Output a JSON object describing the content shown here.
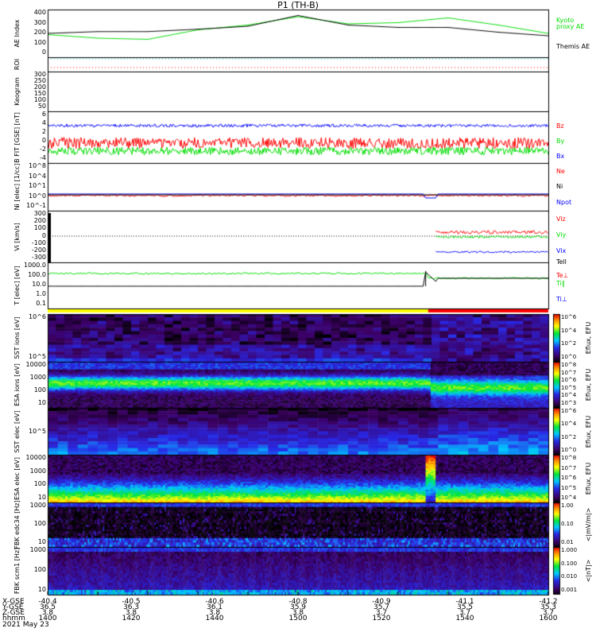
{
  "title": "P1 (TH-B)",
  "date": "2021 May 23",
  "colors": {
    "green": "#00dd00",
    "red": "#ff0000",
    "blue": "#0000ff",
    "yellow": "#ffff00"
  },
  "panels": [
    {
      "id": "ae",
      "label": "AE Index",
      "ticks": [
        "400",
        "300",
        "200",
        "100",
        "0"
      ]
    },
    {
      "id": "roi",
      "label": "ROI",
      "ticks": []
    },
    {
      "id": "keogram",
      "label": "Keogram",
      "ticks": [
        "300",
        "250",
        "200",
        "150",
        "100",
        "50"
      ]
    },
    {
      "id": "bfit",
      "label": "B FIT [GSE] [nT]",
      "ticks": [
        "6",
        "4",
        "2",
        "0",
        "-2",
        "-4"
      ]
    },
    {
      "id": "ni",
      "label": "Ni [elec] [1/cc]",
      "ticks": [
        "10^8",
        "10^4",
        "10^1",
        "10^0",
        "10^-1"
      ]
    },
    {
      "id": "vi",
      "label": "Vi [km/s]",
      "ticks": [
        "300",
        "200",
        "100",
        "0",
        "-100",
        "-200",
        "-300"
      ]
    },
    {
      "id": "t",
      "label": "T [elec] [eV]",
      "ticks": [
        "1000.0",
        "100.0",
        "10.0",
        "1.0",
        "0.1"
      ]
    },
    {
      "id": "sst_i",
      "label": "SST ions [eV]",
      "ticks": [
        "10^6",
        "10^5"
      ]
    },
    {
      "id": "esa_i",
      "label": "ESA ions [eV]",
      "ticks": [
        "10000",
        "1000",
        "100",
        "10"
      ]
    },
    {
      "id": "sst_e",
      "label": "SST elec [eV]",
      "ticks": [
        "10^5"
      ]
    },
    {
      "id": "esa_e",
      "label": "ESA elec [eV]",
      "ticks": [
        "10000",
        "1000",
        "100",
        "10"
      ]
    },
    {
      "id": "fbk1",
      "label": "FBK edc34 [Hz]",
      "ticks": [
        "1000",
        "100",
        "10"
      ]
    },
    {
      "id": "fbk2",
      "label": "FBK scm1 [Hz]",
      "ticks": [
        "1000",
        "100",
        "10"
      ]
    }
  ],
  "legends": {
    "ae": [
      "Kyoto proxy AE",
      "Themis AE"
    ],
    "b": [
      "Bz",
      "By",
      "Bx"
    ],
    "n": [
      "Ne",
      "Ni",
      "Npot"
    ],
    "v": [
      "Viz",
      "Viy",
      "Vix"
    ],
    "t": [
      "Tell",
      "Te⊥",
      "Ti∥",
      "Ti⊥"
    ]
  },
  "colorbars": [
    {
      "ticks": [
        "10^6",
        "10^4",
        "10^2",
        "10^0"
      ],
      "label": "Eflux, EFU"
    },
    {
      "ticks": [
        "10^8",
        "10^7",
        "10^6",
        "10^5",
        "10^4",
        "10^3"
      ],
      "label": "Eflux, EFU"
    },
    {
      "ticks": [
        "10^6",
        "10^4",
        "10^2",
        "10^0"
      ],
      "label": "Eflux, EFU"
    },
    {
      "ticks": [
        "10^8",
        "10^7",
        "10^6",
        "10^5",
        "10^4"
      ],
      "label": "Eflux, EFU"
    },
    {
      "ticks": [
        "1.00",
        "0.10",
        "0.01"
      ],
      "label": "<|mV/m|>"
    },
    {
      "ticks": [
        "1.000",
        "0.100",
        "0.010",
        "0.001"
      ],
      "label": "<|nT|>"
    }
  ],
  "axis": {
    "row_labels": [
      "X-GSE",
      "Y-GSE",
      "Z-GSE",
      "hhmm"
    ],
    "columns": [
      {
        "x": "-40.4",
        "y": "36.5",
        "z": "3.8",
        "t": "1400"
      },
      {
        "x": "-40.5",
        "y": "36.3",
        "z": "3.8",
        "t": "1420"
      },
      {
        "x": "-40.6",
        "y": "36.1",
        "z": "3.8",
        "t": "1440"
      },
      {
        "x": "-40.8",
        "y": "35.9",
        "z": "3.8",
        "t": "1500"
      },
      {
        "x": "-40.9",
        "y": "35.7",
        "z": "3.7",
        "t": "1520"
      },
      {
        "x": "-41.1",
        "y": "35.5",
        "z": "3.7",
        "t": "1540"
      },
      {
        "x": "-41.2",
        "y": "35.3",
        "z": "3.7",
        "t": "1600"
      }
    ]
  },
  "chart_data": {
    "type": "line",
    "title": "P1 (TH-B)",
    "xlabel": "hhmm",
    "x_range": [
      "1400",
      "1600"
    ],
    "ae_index": {
      "ylim": [
        0,
        400
      ],
      "time_min": [
        0,
        20,
        40,
        60,
        80,
        100,
        120,
        140,
        160,
        180,
        200
      ],
      "kyoto_proxy_ae": [
        190,
        160,
        150,
        230,
        270,
        340,
        280,
        290,
        330,
        270,
        200
      ],
      "themis_ae": [
        200,
        215,
        215,
        235,
        260,
        350,
        270,
        250,
        250,
        210,
        180
      ]
    },
    "mode_bar": {
      "slow_survey_until_min": 152,
      "fast_after_min": 152
    }
  }
}
